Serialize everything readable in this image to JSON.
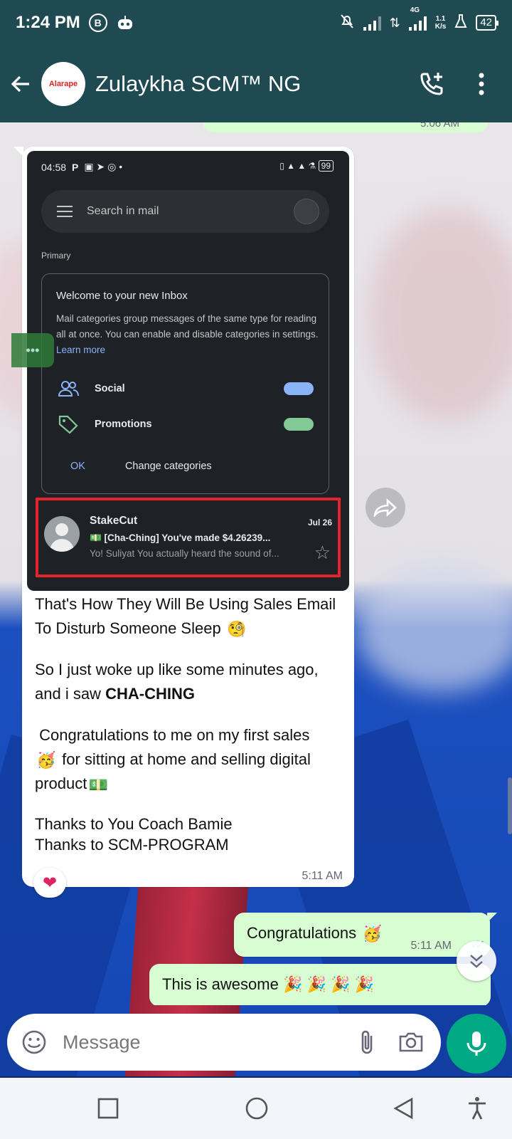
{
  "status_bar": {
    "time": "1:24 PM",
    "network": "4G",
    "speed_value": "1.1",
    "speed_unit": "K/s",
    "battery": "42",
    "icons": [
      "b-circle-icon",
      "robot-icon",
      "mute-icon",
      "signal-icon",
      "data-arrows-icon",
      "signal-icon",
      "flask-icon",
      "battery-icon"
    ]
  },
  "app_bar": {
    "title": "Zulaykha SCM™ NG",
    "avatar_text": "Alarape",
    "back_icon": "arrow-left-icon",
    "call_icon": "add-call-icon",
    "menu_icon": "more-vertical-icon"
  },
  "screenshot": {
    "status_time": "04:58",
    "status_letter": "P",
    "status_right": "99",
    "search_placeholder": "Search in mail",
    "section_label": "Primary",
    "card": {
      "title": "Welcome to your new Inbox",
      "body": "Mail categories group messages of the same type for reading all at once. You can enable and disable categories in settings.",
      "link": "Learn more",
      "categories": [
        {
          "label": "Social",
          "icon": "people-icon",
          "toggle_color": "#8ab4f8"
        },
        {
          "label": "Promotions",
          "icon": "tag-icon",
          "toggle_color": "#81c995"
        }
      ],
      "ok_label": "OK",
      "change_label": "Change categories"
    },
    "email": {
      "sender": "StakeCut",
      "date": "Jul 26",
      "subject": "💵 [Cha-Ching] You've made $4.26239...",
      "snippet": "Yo! Suliyat You actually heard the sound of..."
    }
  },
  "incoming": {
    "line1": "That's How They Will Be Using Sales Email To Disturb Someone Sleep",
    "line2_a": "So I just woke up like some minutes ago,  and i saw",
    "line2_b": "CHA-CHING",
    "line3_a": "Congratulations to me on my first sales",
    "line3_b": "for sitting at home and selling digital product",
    "line4": "Thanks to You Coach Bamie",
    "line5": "Thanks to SCM-PROGRAM",
    "time": "5:11 AM",
    "reaction": "❤",
    "emojis": {
      "monocle": "🧐",
      "party": "🥳",
      "money": "💵"
    }
  },
  "outgoing": [
    {
      "text": "Congratulations",
      "emoji": "🥳",
      "time": "5:11 AM"
    },
    {
      "text": "This is awesome",
      "emoji": "🎉 🎉 🎉 🎉"
    }
  ],
  "previous_time": "5:06 AM",
  "composer": {
    "placeholder": "Message",
    "emoji_icon": "emoji-icon",
    "attach_icon": "paperclip-icon",
    "camera_icon": "camera-icon",
    "mic_icon": "microphone-icon"
  },
  "colors": {
    "header": "#1f4a52",
    "outgoing_bubble": "#d9fdd3",
    "mic_button": "#00a884",
    "highlight_border": "#e3242b"
  }
}
